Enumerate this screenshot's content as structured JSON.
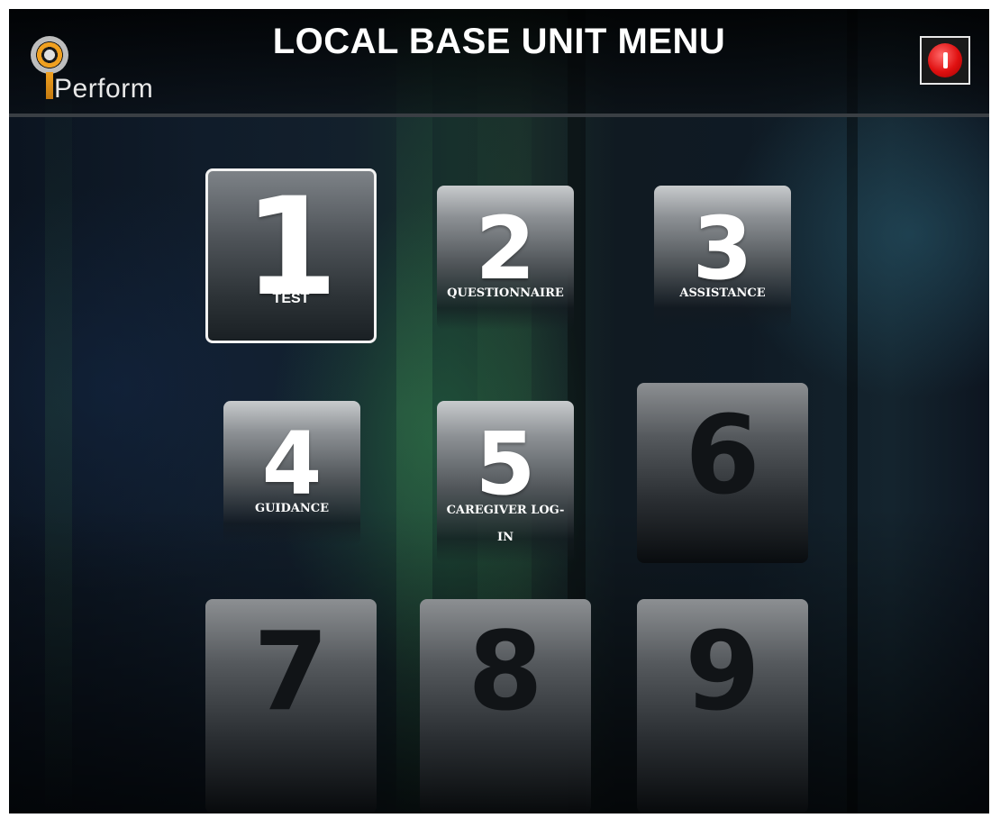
{
  "header": {
    "title": "LOCAL BASE UNIT MENU",
    "logo_text": "Perform"
  },
  "tiles": [
    {
      "number": "1",
      "label": "TEST",
      "state": "selected"
    },
    {
      "number": "2",
      "label": "QUESTIONNAIRE",
      "state": "enabled"
    },
    {
      "number": "3",
      "label": "ASSISTANCE",
      "state": "enabled"
    },
    {
      "number": "4",
      "label": "GUIDANCE",
      "state": "enabled"
    },
    {
      "number": "5",
      "label": "CAREGIVER LOG-",
      "label_line2": "IN",
      "state": "enabled"
    },
    {
      "number": "6",
      "label": "",
      "state": "disabled"
    },
    {
      "number": "7",
      "label": "",
      "state": "disabled"
    },
    {
      "number": "8",
      "label": "",
      "state": "disabled"
    },
    {
      "number": "9",
      "label": "",
      "state": "disabled"
    }
  ],
  "colors": {
    "power_button": "#e01010",
    "logo_accent": "#f0a020"
  }
}
